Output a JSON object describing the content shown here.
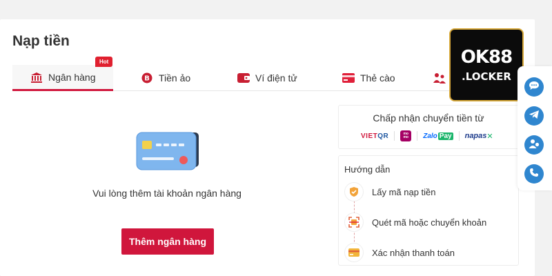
{
  "page": {
    "title": "Nạp tiền"
  },
  "tabs": [
    {
      "label": "Ngân hàng",
      "badge": "Hot",
      "active": true
    },
    {
      "label": "Tiền ảo"
    },
    {
      "label": "Ví điện tử"
    },
    {
      "label": "Thẻ cào"
    },
    {
      "label": ""
    }
  ],
  "empty_state": {
    "message": "Vui lòng thêm tài khoản ngân hàng",
    "button_label": "Thêm ngân hàng"
  },
  "accept": {
    "title": "Chấp nhận chuyển tiền từ",
    "logos": {
      "vietqr_a": "VIET",
      "vietqr_b": "QR",
      "momo": "mo mo",
      "zalo_a": "Zalo",
      "zalo_b": "Pay",
      "napas_a": "napas",
      "napas_b": "✕"
    }
  },
  "guide": {
    "title": "Hướng dẫn",
    "steps": [
      "Lấy mã nạp tiền",
      "Quét mã hoặc chuyển khoản",
      "Xác nhận thanh toán"
    ]
  },
  "brand": {
    "main": "OK88",
    "sub": ".LOCKER"
  },
  "colors": {
    "accent": "#d0163c",
    "fab": "#2f86cf",
    "hot": "#e0202f"
  },
  "icons": {
    "side": [
      "chat-icon",
      "telegram-icon",
      "support-icon",
      "phone-icon"
    ]
  }
}
